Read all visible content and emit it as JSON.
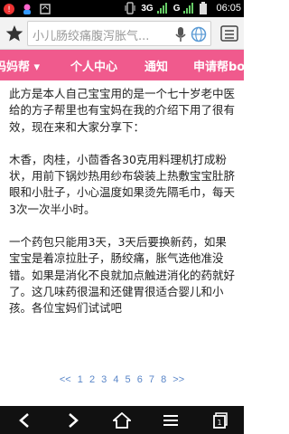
{
  "status_bar": {
    "network_3g": "3G",
    "network_g": "G",
    "time": "06:05"
  },
  "address_bar": {
    "search_text": "小儿肠绞痛腹泻胀气..."
  },
  "nav": {
    "items": [
      {
        "label": "妈妈帮 ▾"
      },
      {
        "label": "个人中心"
      },
      {
        "label": "通知"
      },
      {
        "label": "申请帮bo"
      }
    ]
  },
  "article": {
    "paragraphs": [
      "此方是本人自己宝宝用的是一个七十岁老中医给的方子帮里也有宝妈在我的介绍下用了很有效，现在来和大家分享下：",
      "木香，肉桂，小茴香各30克用料理机打成粉状，用前下锅炒热用纱布袋装上热敷宝宝肚脐眼和小肚子，小心温度如果烫先隔毛巾，每天3次一次半小时。",
      "一个药包只能用3天，3天后要换新药，如果宝宝是着凉拉肚子，肠绞痛，胀气选他准没错。如果是消化不良就加点触进消化的药就好了。这几味药很温和还健胃很适合婴儿和小孩。各位宝妈们试试吧"
    ]
  },
  "pagination": {
    "prev": "<<",
    "pages": [
      "1",
      "2",
      "3",
      "4",
      "5",
      "6",
      "7",
      "8"
    ],
    "next": ">>"
  },
  "icons": {
    "status_left": [
      "notification-icon",
      "baby-icon",
      "sync-icon"
    ],
    "status_right": [
      "vibrate-icon",
      "signal-icon",
      "signal-icon",
      "battery-icon"
    ],
    "address": [
      "star-icon",
      "mic-icon",
      "globe-icon",
      "menu-icon"
    ],
    "bottom_nav": [
      "back-icon",
      "forward-icon",
      "home-icon",
      "menu-lines-icon",
      "tabs-icon"
    ]
  },
  "colors": {
    "nav_pink": "#f05a8d",
    "link_blue": "#5a86c8",
    "status_black": "#000000"
  }
}
